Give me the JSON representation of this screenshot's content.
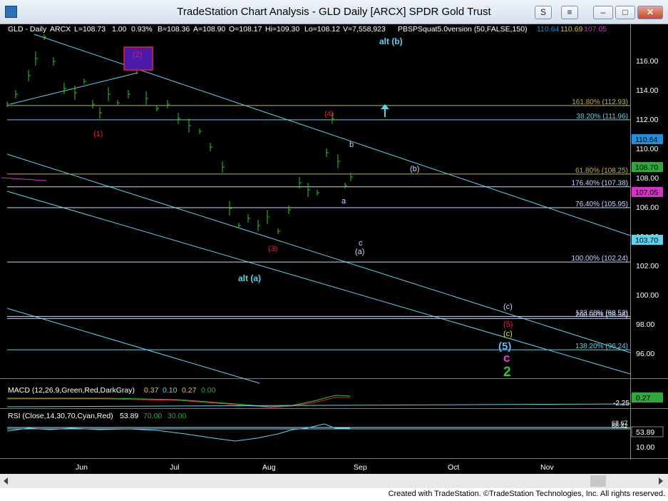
{
  "window": {
    "title": "TradeStation Chart Analysis - GLD Daily [ARCX] SPDR Gold Trust",
    "buttons": {
      "s": "S",
      "menu": "≡",
      "minimize": "–",
      "maximize": "□",
      "close": "✕"
    }
  },
  "header": {
    "symbol": "GLD - Daily",
    "exchange": "ARCX",
    "last": "L=108.73",
    "change": "1.00",
    "pct": "0.93%",
    "bid": "B=108.36",
    "ask": "A=108.90",
    "open": "O=108.17",
    "high": "Hi=109.30",
    "low": "Lo=108.12",
    "volume": "V=7,558,923",
    "indicator": "PBSPSquat5.0version (50,FALSE,150)",
    "ind_v1": "110.64",
    "ind_v2": "110.69",
    "ind_v3": "107.05"
  },
  "price_axis": {
    "labels": [
      "116.00",
      "114.00",
      "112.00",
      "110.00",
      "108.00",
      "106.00",
      "104.00",
      "102.00",
      "100.00",
      "98.00",
      "96.00"
    ],
    "tags": [
      {
        "label": "110.64",
        "color": "#1e8fd8"
      },
      {
        "label": "108.70",
        "color": "#2ea83a"
      },
      {
        "label": "107.05",
        "color": "#d830c8"
      },
      {
        "label": "103.70",
        "color": "#5fd3ea"
      }
    ]
  },
  "fib_levels": [
    {
      "label": "161.80% (112.93)",
      "value": 112.93,
      "color": "#c2b43a"
    },
    {
      "label": "38.20% (111.96)",
      "value": 111.96,
      "color": "#5fd3ea"
    },
    {
      "label": "61.80% (108.25)",
      "value": 108.25,
      "color": "#c2b43a"
    },
    {
      "label": "176.40% (107.38)",
      "value": 107.38,
      "color": "#c8d8ff"
    },
    {
      "label": "76.40% (105.95)",
      "value": 105.95,
      "color": "#c8d8ff"
    },
    {
      "label": "100.00% (102.24)",
      "value": 102.24,
      "color": "#c8d8ff"
    },
    {
      "label": "123.60% (98.52)",
      "value": 98.52,
      "color": "#c8d8ff"
    },
    {
      "label": "200.00% (98.38)",
      "value": 98.38,
      "color": "#c8d8ff"
    },
    {
      "label": "138.20% (96.24)",
      "value": 96.24,
      "color": "#5fd3ea"
    }
  ],
  "wave_labels": [
    {
      "text": "alt (b)",
      "color": "#5fd3ea"
    },
    {
      "text": "(2)",
      "color": "#e8203a"
    },
    {
      "text": "(1)",
      "color": "#e8203a"
    },
    {
      "text": "(4)",
      "color": "#e8203a"
    },
    {
      "text": "b",
      "color": "#c8d8ff"
    },
    {
      "text": "(b)",
      "color": "#c8d8ff"
    },
    {
      "text": "a",
      "color": "#c8d8ff"
    },
    {
      "text": "c",
      "color": "#c8d8ff"
    },
    {
      "text": "(a)",
      "color": "#c8d8ff"
    },
    {
      "text": "(3)",
      "color": "#e8203a"
    },
    {
      "text": "alt (a)",
      "color": "#5fd3ea"
    },
    {
      "text": "(c)",
      "color": "#c8d8ff"
    },
    {
      "text": "(5)",
      "color": "#e8203a"
    },
    {
      "text": "(c)",
      "color": "#f0e020"
    },
    {
      "text": "(5)",
      "color": "#5fb8f0"
    },
    {
      "text": "c",
      "color": "#e040e0"
    },
    {
      "text": "2",
      "color": "#2ec82e"
    }
  ],
  "macd": {
    "label": "MACD (12,26,9,Green,Red,DarkGray)",
    "v1": "0.37",
    "v2": "0.10",
    "v3": "0.27",
    "v4": "0.00",
    "axis_label": "-2.25",
    "tag": "0.27"
  },
  "rsi": {
    "label": "RSI (Close,14,30,70,Cyan,Red)",
    "v1": "53.89",
    "v2": "70.00",
    "v3": "30.00",
    "axis_a": "68.67",
    "axis_b": "66.42",
    "axis_c": "10.00",
    "tag": "53.89"
  },
  "time_axis": [
    "Jun",
    "Jul",
    "Aug",
    "Sep",
    "Oct",
    "Nov"
  ],
  "footer": "Created with TradeStation. ©TradeStation Technologies, Inc. All rights reserved."
}
